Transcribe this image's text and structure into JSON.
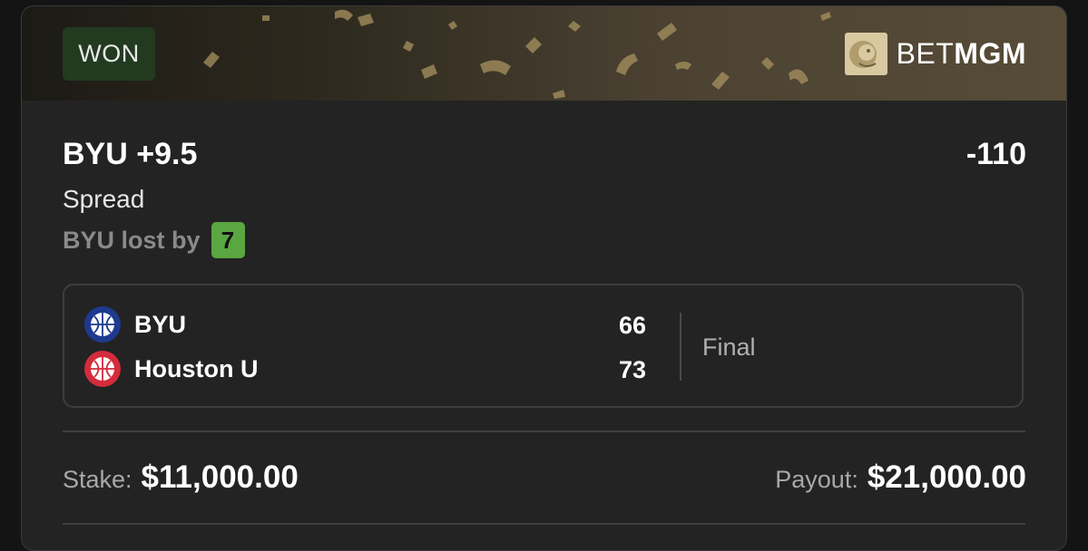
{
  "colors": {
    "won_badge_bg": "#223a1f",
    "margin_badge_bg": "#5aa640",
    "card_bg": "#232323",
    "byu_blue": "#1d3a8f",
    "houston_red": "#d32c3c"
  },
  "banner": {
    "status": "WON",
    "brand": {
      "prefix": "BET",
      "suffix": "MGM",
      "icon": "lion-logo-icon"
    }
  },
  "bet": {
    "selection": "BYU +9.5",
    "odds": "-110",
    "market": "Spread",
    "result_text": "BYU lost by",
    "result_margin": "7"
  },
  "game": {
    "teams": [
      {
        "name": "BYU",
        "score": "66",
        "icon": "basketball-icon"
      },
      {
        "name": "Houston U",
        "score": "73",
        "icon": "basketball-icon"
      }
    ],
    "status": "Final"
  },
  "summary": {
    "stake_label": "Stake:",
    "stake_value": "$11,000.00",
    "payout_label": "Payout:",
    "payout_value": "$21,000.00"
  }
}
